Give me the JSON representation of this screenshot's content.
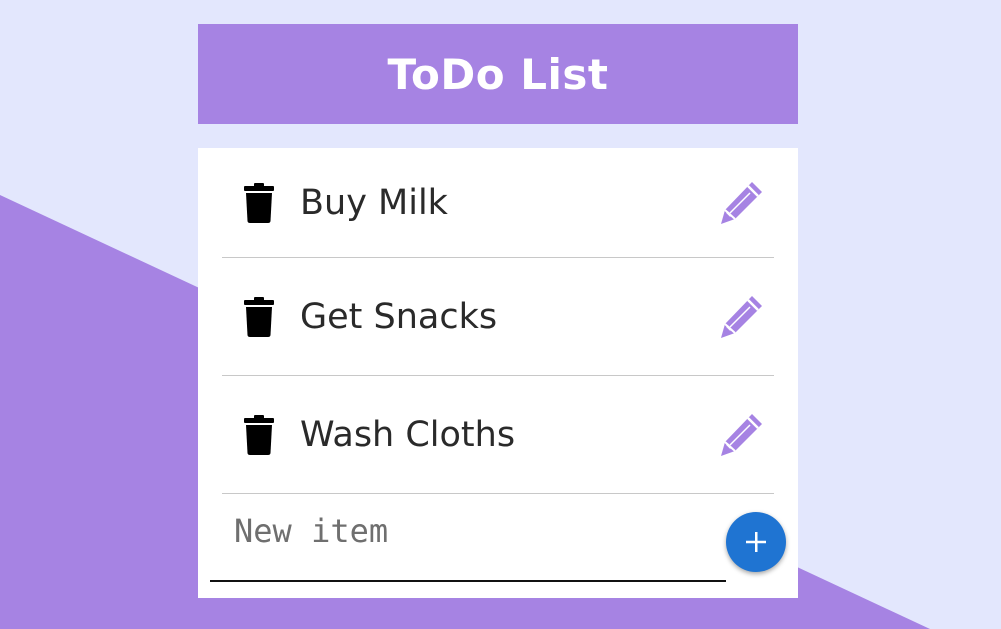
{
  "app": {
    "title": "ToDo List"
  },
  "items": [
    {
      "text": "Buy Milk"
    },
    {
      "text": "Get Snacks"
    },
    {
      "text": "Wash Cloths"
    }
  ],
  "new_item": {
    "placeholder": "New item",
    "value": ""
  },
  "icons": {
    "delete": "trash-icon",
    "edit": "pencil-icon",
    "add": "plus-icon"
  },
  "colors": {
    "background": "#e3e7fd",
    "accent": "#a683e3",
    "add_button": "#1f74d2"
  }
}
